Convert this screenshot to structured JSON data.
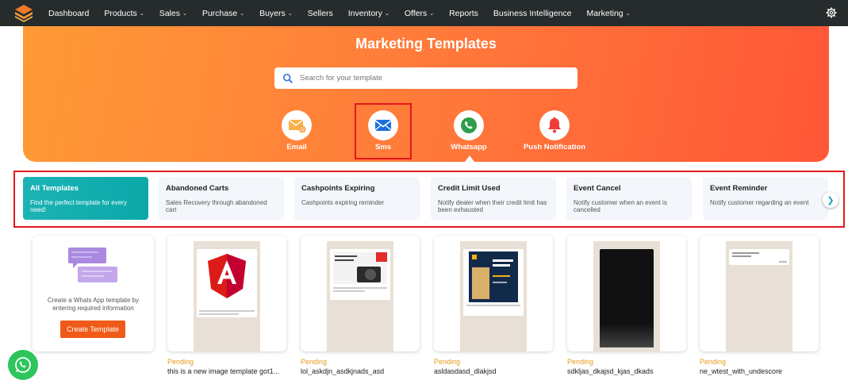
{
  "nav": {
    "items": [
      {
        "label": "Dashboard",
        "dropdown": false
      },
      {
        "label": "Products",
        "dropdown": true
      },
      {
        "label": "Sales",
        "dropdown": true
      },
      {
        "label": "Purchase",
        "dropdown": true
      },
      {
        "label": "Buyers",
        "dropdown": true
      },
      {
        "label": "Sellers",
        "dropdown": false
      },
      {
        "label": "Inventory",
        "dropdown": true
      },
      {
        "label": "Offers",
        "dropdown": true
      },
      {
        "label": "Reports",
        "dropdown": false
      },
      {
        "label": "Business Intelligence",
        "dropdown": false
      },
      {
        "label": "Marketing",
        "dropdown": true
      }
    ],
    "chevron": "⌄",
    "settings_icon": "gear-icon"
  },
  "hero": {
    "title": "Marketing Templates",
    "search_placeholder": "Search for your template",
    "channels": [
      {
        "label": "Email",
        "icon": "email-icon"
      },
      {
        "label": "Sms",
        "icon": "sms-icon",
        "selected": true
      },
      {
        "label": "Whatsapp",
        "icon": "whatsapp-icon"
      },
      {
        "label": "Push Notification",
        "icon": "bell-icon"
      }
    ]
  },
  "categories": [
    {
      "title": "All Templates",
      "desc": "Find the perfect template for every need!",
      "active": true
    },
    {
      "title": "Abandoned Carts",
      "desc": "Sales Recovery through abandoned cart"
    },
    {
      "title": "Cashpoints Expiring",
      "desc": "Cashpoints expiring reminder"
    },
    {
      "title": "Credit Limit Used",
      "desc": "Notify dealer when their credit limit has been exhausted"
    },
    {
      "title": "Event Cancel",
      "desc": "Notify customer when an event is cancelled"
    },
    {
      "title": "Event Reminder",
      "desc": "Notify customer regarding an event"
    }
  ],
  "create_card": {
    "text": "Create a Whats App template by entering required information",
    "button": "Create Template"
  },
  "templates": [
    {
      "status": "Pending",
      "name": "this is a new image template got1...",
      "kind": "angular"
    },
    {
      "status": "Pending",
      "name": "lol_askdjn_asdkjnads_asd",
      "kind": "camera"
    },
    {
      "status": "Pending",
      "name": "asldasdasd_dlakjsd",
      "kind": "poster"
    },
    {
      "status": "Pending",
      "name": "sdkljas_dkajsd_kjas_dkads",
      "kind": "dark"
    },
    {
      "status": "Pending",
      "name": "ne_wtest_with_undescore",
      "kind": "text"
    }
  ],
  "colors": {
    "accent": "#ef5a19",
    "nav_bg": "#262b2c",
    "active_category": "#1cb3b5",
    "pending": "#e59a1a",
    "highlight": "#e3171b"
  }
}
